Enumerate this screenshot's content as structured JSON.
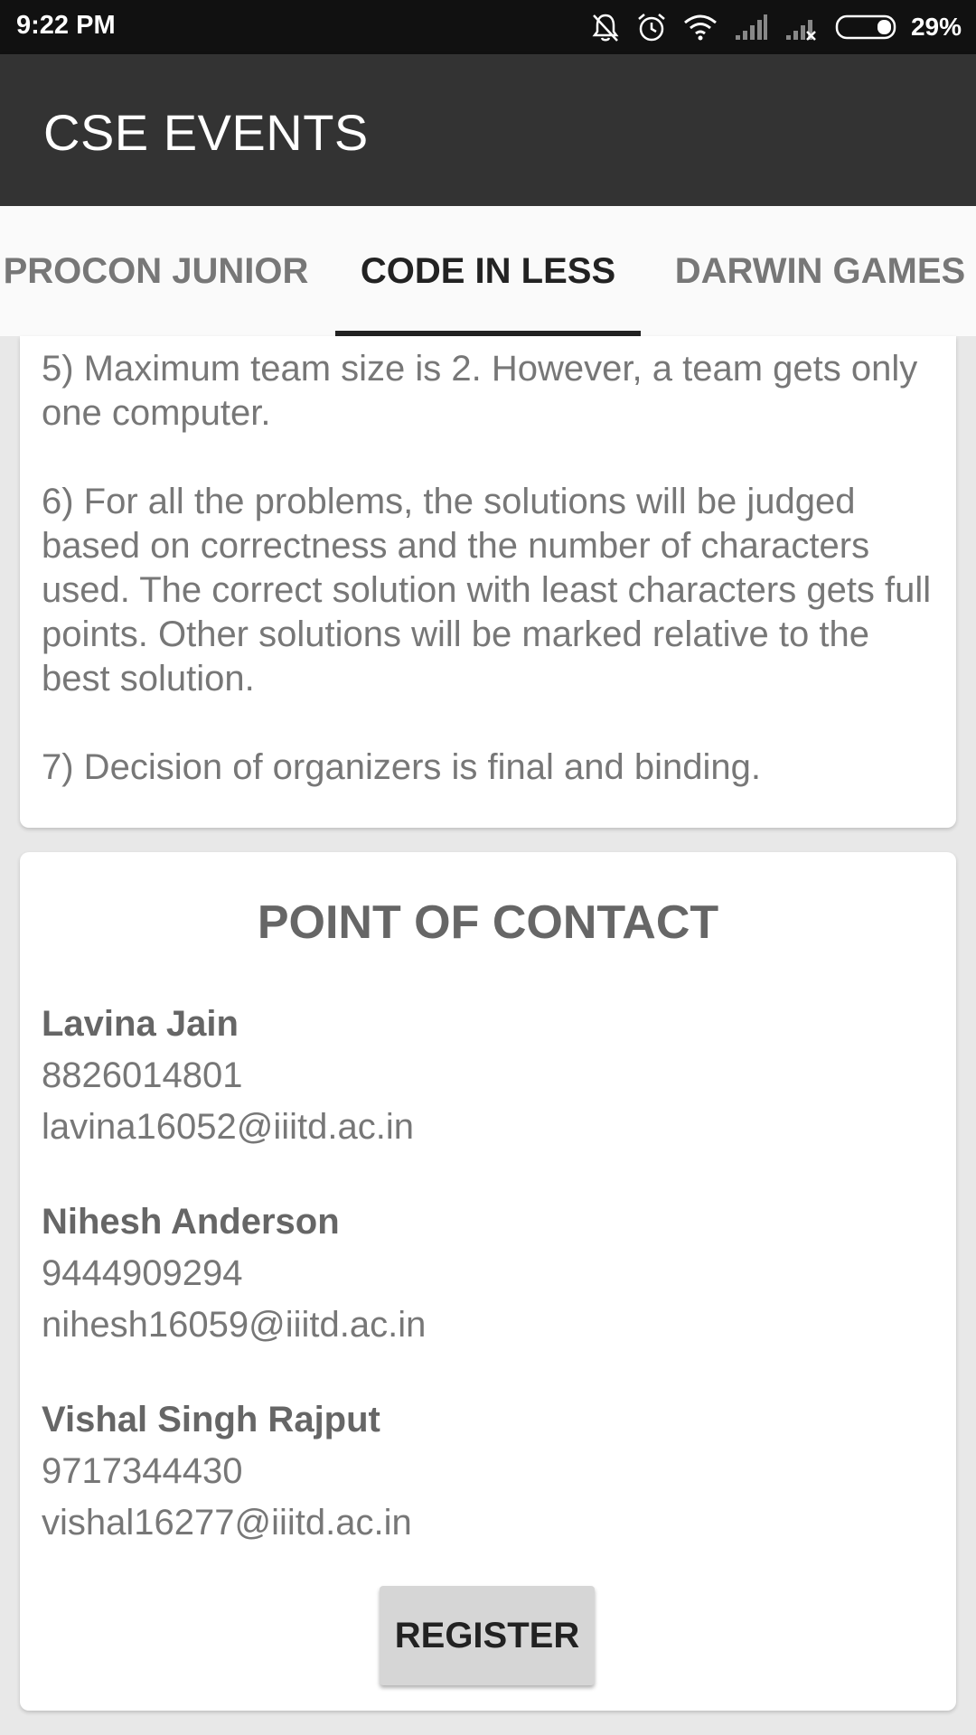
{
  "status_bar": {
    "time": "9:22 PM",
    "battery": "29%",
    "icons": [
      "bell-off-icon",
      "alarm-icon",
      "wifi-icon",
      "signal-icon",
      "signal-no-service-icon",
      "battery-icon"
    ]
  },
  "app_bar": {
    "title": "CSE EVENTS"
  },
  "tabs": [
    {
      "label": "PROCON JUNIOR",
      "active": false
    },
    {
      "label": "CODE IN LESS",
      "active": true
    },
    {
      "label": "DARWIN GAMES",
      "active": false
    }
  ],
  "rules": [
    " 5) Maximum team size is 2. However, a team gets only one computer.",
    " 6) For all the problems, the solutions will be judged based on correctness and the number of characters used. The correct solution with least characters gets full points. Other solutions will be marked relative to the best solution.",
    " 7) Decision of organizers is final and binding."
  ],
  "contact": {
    "heading": "POINT OF CONTACT",
    "people": [
      {
        "name": "Lavina Jain",
        "phone": "8826014801",
        "email": "lavina16052@iiitd.ac.in"
      },
      {
        "name": "Nihesh Anderson",
        "phone": "9444909294",
        "email": "nihesh16059@iiitd.ac.in"
      },
      {
        "name": "Vishal Singh Rajput",
        "phone": "9717344430",
        "email": "vishal16277@iiitd.ac.in"
      }
    ]
  },
  "register_label": "REGISTER",
  "colors": {
    "status_bar": "#111111",
    "app_bar": "#333333",
    "tab_bar": "#fafafa",
    "tab_indicator": "#222222",
    "background": "#e8e8e8",
    "button": "#d6d6d6"
  }
}
